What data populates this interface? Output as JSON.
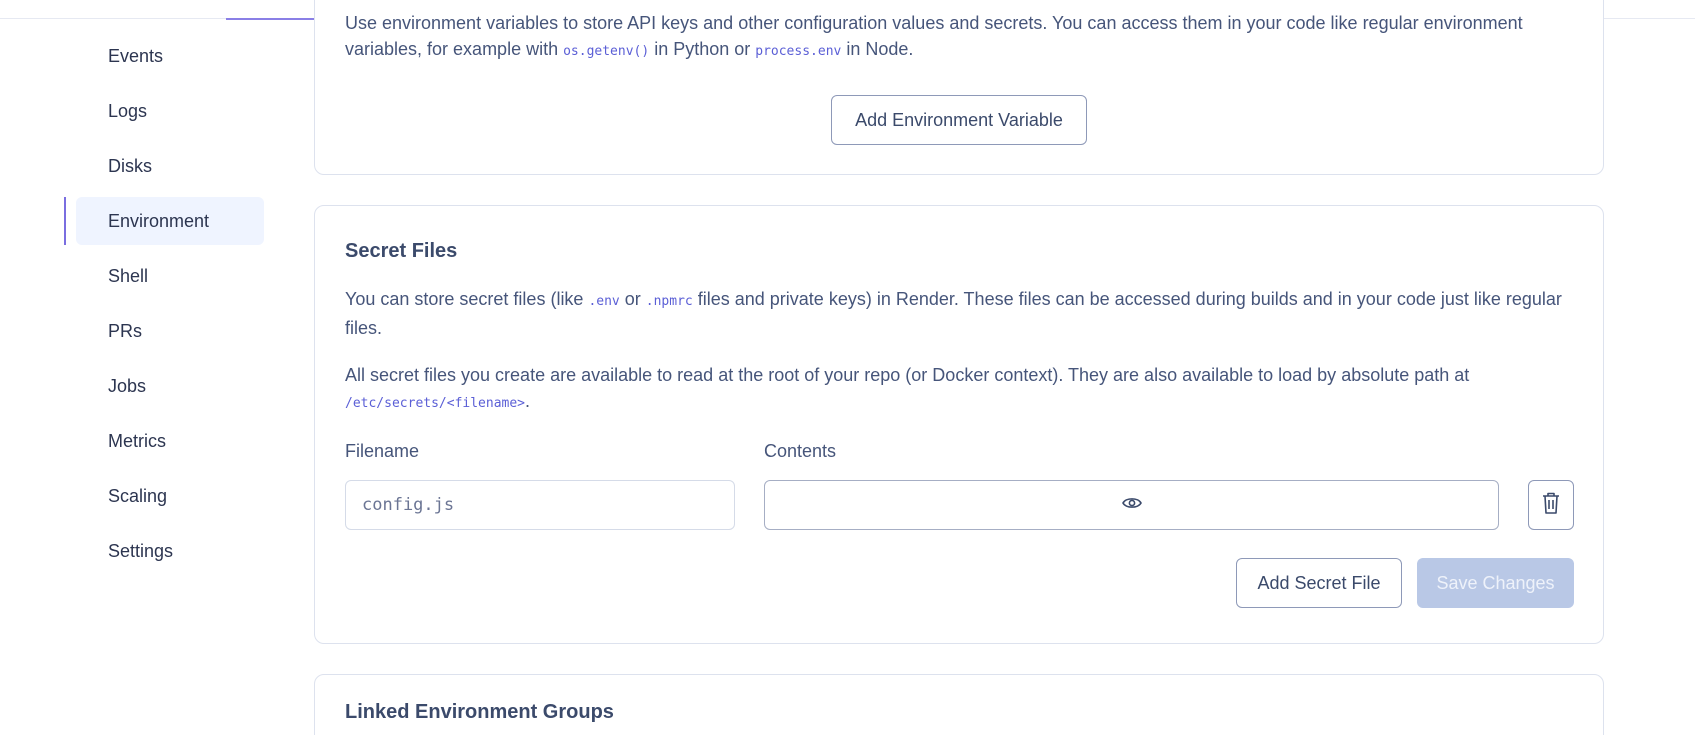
{
  "sidebar": {
    "items": [
      {
        "label": "Events"
      },
      {
        "label": "Logs"
      },
      {
        "label": "Disks"
      },
      {
        "label": "Environment",
        "active": true
      },
      {
        "label": "Shell"
      },
      {
        "label": "PRs"
      },
      {
        "label": "Jobs"
      },
      {
        "label": "Metrics"
      },
      {
        "label": "Scaling"
      },
      {
        "label": "Settings"
      }
    ]
  },
  "env_section": {
    "desc_pre": "Use environment variables to store API keys and other configuration values and secrets. You can access them in your code like regular environment variables, for example with ",
    "code1": "os.getenv()",
    "desc_mid": " in Python or ",
    "code2": "process.env",
    "desc_post": " in Node.",
    "add_button": "Add Environment Variable"
  },
  "secret_files": {
    "title": "Secret Files",
    "desc1_pre": "You can store secret files (like ",
    "desc1_code1": ".env",
    "desc1_mid": " or ",
    "desc1_code2": ".npmrc",
    "desc1_post": " files and private keys) in Render. These files can be accessed during builds and in your code just like regular files.",
    "desc2_pre": "All secret files you create are available to read at the root of your repo (or Docker context). They are also available to load by absolute path at ",
    "desc2_code": "/etc/secrets/<filename>",
    "desc2_post": ".",
    "filename_label": "Filename",
    "contents_label": "Contents",
    "filename_value": "config.js",
    "add_button": "Add Secret File",
    "save_button": "Save Changes"
  },
  "linked": {
    "title": "Linked Environment Groups"
  },
  "icons": {
    "eye": "eye-icon",
    "delete": "trash-icon"
  },
  "colors": {
    "accent": "#7a6ee0",
    "active_bg": "#eff4ff",
    "code": "#5b5fd6",
    "save_disabled": "#b9c8e6"
  }
}
